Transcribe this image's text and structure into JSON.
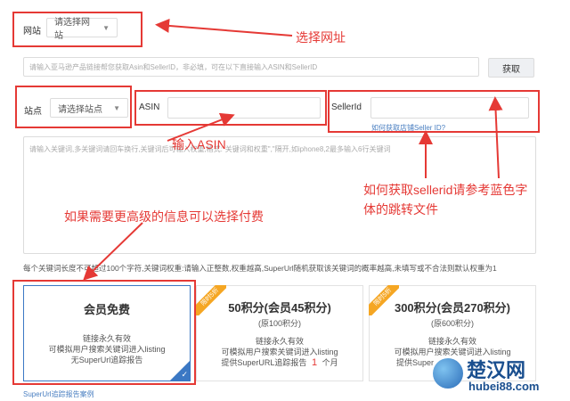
{
  "site": {
    "label": "网站",
    "select_value": "请选择网站"
  },
  "url_input": {
    "placeholder": "请输入亚马逊产品链接帮您获取Asin和SellerID，非必填，可在以下直接输入ASIN和SellerID"
  },
  "fetch_button": {
    "label": "获取"
  },
  "station": {
    "label": "站点",
    "select_value": "请选择站点"
  },
  "asin": {
    "label": "ASIN",
    "value": ""
  },
  "sellerid": {
    "label": "SellerId",
    "value": "",
    "help_link": "如何获取店铺Seller ID?"
  },
  "keywords": {
    "placeholder": "请输入关键词,多关键词请回车换行,关键词后可输入权重,格式:\"关键词和权重\",\"隔开,如iphone8,2最多输入6行关键词"
  },
  "hint": "每个关键词长度不可超过100个字符,关键词权重:请输入正整数,权重越高,SuperUrl随机获取该关键词的概率越高,未填写或不合法则默认权重为1",
  "plans": [
    {
      "badge": "",
      "title": "会员免费",
      "sub": "",
      "lines": [
        "链接永久有效",
        "可模拟用户搜索关键词进入listing",
        "无SuperUrl追踪报告"
      ]
    },
    {
      "badge": "限时5折",
      "title": "50积分(会员45积分)",
      "sub": "(原100积分)",
      "lines": [
        "链接永久有效",
        "可模拟用户搜索关键词进入listing"
      ],
      "report_prefix": "提供SuperURL追踪报告",
      "report_num": "1",
      "report_suffix": "个月"
    },
    {
      "badge": "限时5折",
      "title": "300积分(会员270积分)",
      "sub": "(原600积分)",
      "lines": [
        "链接永久有效",
        "可模拟用户搜索关键词进入listing",
        "提供Super"
      ]
    }
  ],
  "report_example_link": "SuperUrl追踪报告案例",
  "annotations": {
    "select_site": "选择网址",
    "enter_asin": "输入ASIN",
    "sellerid_help_1": "如何获取sellerid请参考蓝色字",
    "sellerid_help_2": "体的跳转文件",
    "paid_note": "如果需要更高级的信息可以选择付费"
  },
  "watermark": {
    "text": "楚汉网",
    "url": "hubei88.com"
  },
  "colors": {
    "annotation_red": "#e53935",
    "link_blue": "#4a7fc1",
    "badge_orange": "#f5a623",
    "selected_blue": "#3b78c4"
  }
}
